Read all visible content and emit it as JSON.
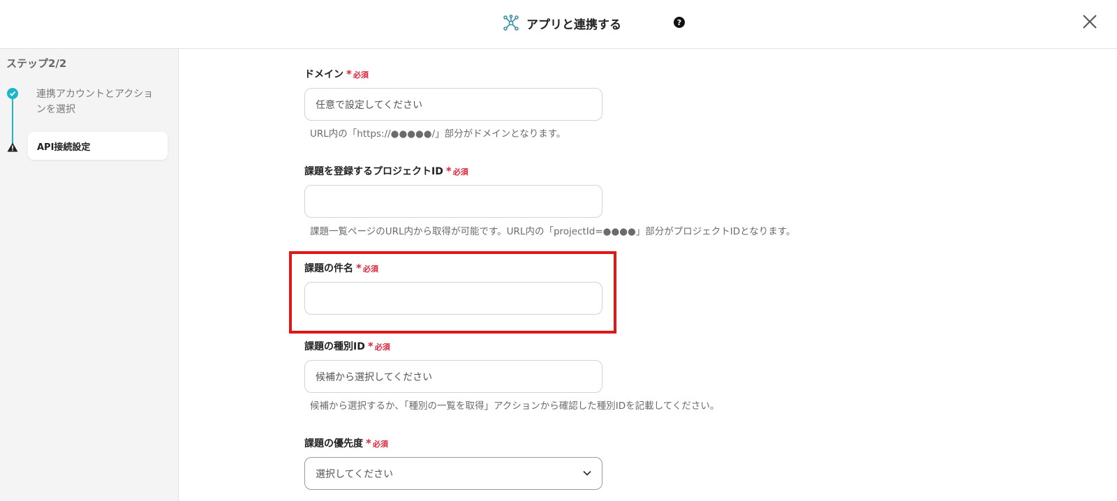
{
  "header": {
    "title": "アプリと連携する",
    "help_symbol": "?"
  },
  "sidebar": {
    "step_label": "ステップ2/2",
    "steps": [
      {
        "label": "連携アカウントとアクションを選択",
        "status": "done"
      },
      {
        "label": "API接続設定",
        "status": "warning"
      }
    ]
  },
  "form": {
    "required_text": "必須",
    "required_star": "*",
    "fields": [
      {
        "label": "ドメイン",
        "placeholder": "任意で設定してください",
        "help": "URL内の「https://●●●●●/」部分がドメインとなります。"
      },
      {
        "label": "課題を登録するプロジェクトID",
        "placeholder": "",
        "help": "課題一覧ページのURL内から取得が可能です。URL内の「projectId=●●●●」部分がプロジェクトIDとなります。"
      },
      {
        "label": "課題の件名",
        "placeholder": "",
        "help": ""
      },
      {
        "label": "課題の種別ID",
        "placeholder": "候補から選択してください",
        "help": "候補から選択するか、「種別の一覧を取得」アクションから確認した種別IDを記載してください。"
      },
      {
        "label": "課題の優先度",
        "placeholder": "選択してください",
        "help": ""
      }
    ]
  },
  "colors": {
    "accent": "#1bb6c9",
    "required": "#e0243a",
    "highlight": "#e01717"
  }
}
